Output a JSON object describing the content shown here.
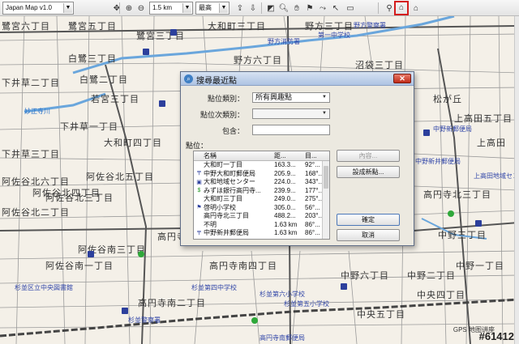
{
  "toolbar": {
    "map_select": "Japan Map v1.0",
    "scale_select": "1.5 km",
    "detail_select": "最高",
    "zoom_in_icon": "zoom-in-icon",
    "zoom_out_icon": "zoom-out-icon",
    "active_tool": "find-nearest-icon"
  },
  "map": {
    "labels": [
      "鷺宮六丁目",
      "鷺宮五丁目",
      "鷺宮三丁目",
      "白鷺三丁目",
      "野方六丁目",
      "沼袋三丁目",
      "白鷺二丁目",
      "下井草二丁目",
      "下井草一丁目",
      "大和町三丁目",
      "野方三丁目",
      "若宮三丁目",
      "大和町四丁目",
      "下井草三丁目",
      "松が丘",
      "上高田五丁目",
      "阿佐谷北五丁目",
      "阿佐谷北四丁目",
      "阿佐谷北六丁目",
      "阿佐谷北三丁目",
      "阿佐谷北二丁目",
      "高円寺北四丁目",
      "高円寺北三丁目",
      "阿佐谷南一丁目",
      "阿佐谷南三丁目",
      "高円寺南四丁目",
      "高円寺南二丁目",
      "中野一丁目",
      "中野二丁目",
      "中野六丁目",
      "中央五丁目",
      "中央四丁目",
      "上高田",
      "中野三丁目"
    ],
    "poi_labels": [
      "第一中学校",
      "野方消防署",
      "野方警察署",
      "杉並第四中学校",
      "杉並第六小学校",
      "杉並区立中央図書館",
      "杉並警察署",
      "杉並第五小学校",
      "中野新郵便局",
      "中野新井郵便局",
      "上高田地域センター",
      "高円寺南郵便局"
    ],
    "water_label": "妙正寺川",
    "gps_label": "GPS 地图讲座",
    "watermark": "#61412"
  },
  "dialog": {
    "title": "搜尋最近點",
    "category_label": "點位類別：",
    "category_value": "所有興趣點",
    "subcategory_label": "點位次類別：",
    "subcategory_value": "",
    "contains_label": "包含：",
    "contains_value": "",
    "points_label": "點位：",
    "columns": {
      "name": "名稱",
      "distance": "距...",
      "direction": "目..."
    },
    "rows": [
      {
        "icon": "none",
        "name": "大和町一丁目",
        "distance": "163.3...",
        "direction": "92°..."
      },
      {
        "icon": "post-office",
        "name": "中野大和町郵便局",
        "distance": "205.9...",
        "direction": "168°..."
      },
      {
        "icon": "building",
        "name": "大和地域センター",
        "distance": "224.0...",
        "direction": "343°..."
      },
      {
        "icon": "dollar",
        "name": "みずほ銀行高円寺...",
        "distance": "239.9...",
        "direction": "177°..."
      },
      {
        "icon": "none",
        "name": "大和町三丁目",
        "distance": "249.0...",
        "direction": "275°..."
      },
      {
        "icon": "school",
        "name": "啓明小学校",
        "distance": "305.0...",
        "direction": "56°..."
      },
      {
        "icon": "none",
        "name": "高円寺北三丁目",
        "distance": "488.2...",
        "direction": "203°..."
      },
      {
        "icon": "none",
        "name": "不明",
        "distance": "1.63 km",
        "direction": "86°..."
      },
      {
        "icon": "post-office",
        "name": "中野新井郵便局",
        "distance": "1.63 km",
        "direction": "86°..."
      }
    ],
    "buttons": {
      "content": "內容...",
      "set_origin": "設成新點...",
      "ok": "確定",
      "cancel": "取消"
    }
  }
}
